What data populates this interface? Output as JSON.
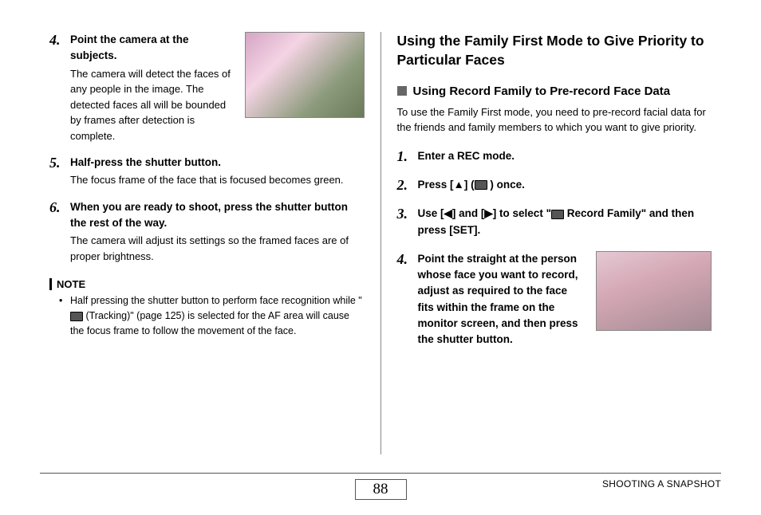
{
  "left": {
    "step4": {
      "num": "4.",
      "title": "Point the camera at the subjects.",
      "desc": "The camera will detect the faces of any people in the image. The detected faces all will be bounded by frames after detection is complete."
    },
    "step5": {
      "num": "5.",
      "title": "Half-press the shutter button.",
      "desc": "The focus frame of the face that is focused becomes green."
    },
    "step6": {
      "num": "6.",
      "title": "When you are ready to shoot, press the shutter button the rest of the way.",
      "desc": "The camera will adjust its settings so the framed faces are of proper brightness."
    },
    "note": {
      "label": "NOTE",
      "item_pre": "Half pressing the shutter button to perform face recognition while \"",
      "item_mid": " (Tracking)\" (page 125) is selected for the AF area will cause the focus frame to follow the movement of the face."
    }
  },
  "right": {
    "title": "Using the Family First Mode to Give Priority to Particular Faces",
    "subhead": "Using Record Family to Pre-record Face Data",
    "intro": "To use the Family First mode, you need to pre-record facial data for the friends and family members to which you want to give priority.",
    "step1": {
      "num": "1.",
      "title": "Enter a REC mode."
    },
    "step2": {
      "num": "2.",
      "pre": "Press [",
      "tri": "▲",
      "mid": "] (",
      "post": " ) once."
    },
    "step3": {
      "num": "3.",
      "pre": "Use [",
      "l": "◀",
      "mid1": "] and [",
      "r": "▶",
      "mid2": "] to select \"",
      "post": " Record Family\" and then press [SET]."
    },
    "step4": {
      "num": "4.",
      "title": "Point the straight at the person whose face you want to record, adjust as required to the face fits within the frame on the monitor screen, and then press the shutter button."
    }
  },
  "footer": {
    "page": "88",
    "label": "SHOOTING A SNAPSHOT"
  }
}
